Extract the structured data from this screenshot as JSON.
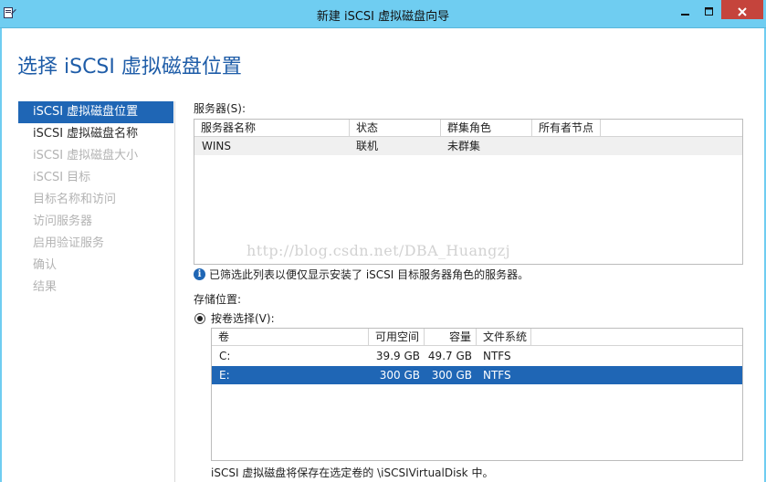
{
  "window": {
    "title": "新建 iSCSI 虚拟磁盘向导",
    "icons": {
      "app": "wizard-app-icon",
      "minimize": "minimize-icon",
      "maximize": "maximize-icon",
      "close": "close-icon"
    }
  },
  "page": {
    "title": "选择 iSCSI 虚拟磁盘位置"
  },
  "steps": [
    {
      "label": "iSCSI 虚拟磁盘位置",
      "state": "active"
    },
    {
      "label": "iSCSI 虚拟磁盘名称",
      "state": "enabled"
    },
    {
      "label": "iSCSI 虚拟磁盘大小",
      "state": "disabled"
    },
    {
      "label": "iSCSI 目标",
      "state": "disabled"
    },
    {
      "label": "目标名称和访问",
      "state": "disabled"
    },
    {
      "label": "访问服务器",
      "state": "disabled"
    },
    {
      "label": "启用验证服务",
      "state": "disabled"
    },
    {
      "label": "确认",
      "state": "disabled"
    },
    {
      "label": "结果",
      "state": "disabled"
    }
  ],
  "servers": {
    "label": "服务器(S):",
    "columns": [
      "服务器名称",
      "状态",
      "群集角色",
      "所有者节点"
    ],
    "rows": [
      {
        "name": "WINS",
        "status": "联机",
        "cluster_role": "未群集",
        "owner_node": ""
      }
    ]
  },
  "watermark": "http://blog.csdn.net/DBA_Huangzj",
  "info": {
    "icon": "info-icon",
    "text": "已筛选此列表以便仅显示安装了 iSCSI 目标服务器角色的服务器。"
  },
  "storage": {
    "label": "存储位置:",
    "radio_label": "按卷选择(V):",
    "radio_selected": true,
    "columns": [
      "卷",
      "可用空间",
      "容量",
      "文件系统"
    ],
    "rows": [
      {
        "volume": "C:",
        "free": "39.9 GB",
        "capacity": "49.7 GB",
        "fs": "NTFS",
        "selected": false
      },
      {
        "volume": "E:",
        "free": "300 GB",
        "capacity": "300 GB",
        "fs": "NTFS",
        "selected": true
      }
    ]
  },
  "footer_note": "iSCSI 虚拟磁盘将保存在选定卷的 \\iSCSIVirtualDisk 中。",
  "colors": {
    "titlebar": "#6fcdf1",
    "accent": "#1f66b5",
    "close": "#c5443c",
    "page_title": "#1f5da8"
  }
}
